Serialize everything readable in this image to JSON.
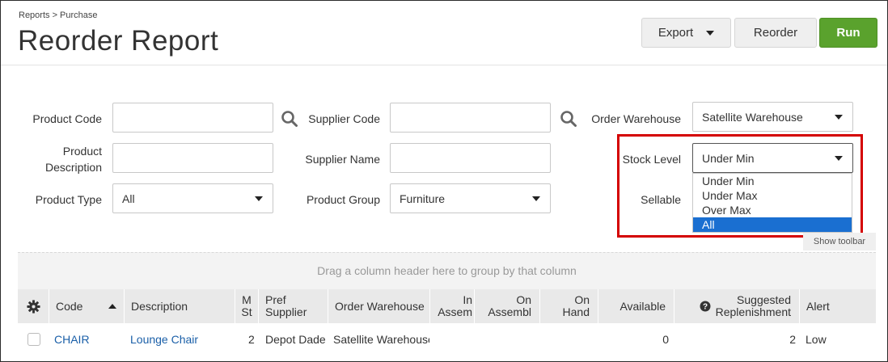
{
  "breadcrumb": "Reports > Purchase",
  "title": "Reorder Report",
  "toolbar": {
    "export": "Export",
    "reorder": "Reorder",
    "run": "Run"
  },
  "filters": {
    "product_code": {
      "label": "Product Code",
      "value": ""
    },
    "supplier_code": {
      "label": "Supplier Code",
      "value": ""
    },
    "order_warehouse": {
      "label": "Order Warehouse",
      "value": "Satellite Warehouse"
    },
    "product_description": {
      "label_line1": "Product",
      "label_line2": "Description",
      "value": ""
    },
    "supplier_name": {
      "label": "Supplier Name",
      "value": ""
    },
    "stock_level": {
      "label": "Stock Level",
      "value": "Under Min",
      "options": [
        "Under Min",
        "Under Max",
        "Over Max",
        "All"
      ],
      "highlighted": "All"
    },
    "product_type": {
      "label": "Product Type",
      "value": "All"
    },
    "product_group": {
      "label": "Product Group",
      "value": "Furniture"
    },
    "sellable": {
      "label": "Sellable"
    }
  },
  "show_toolbar": "Show toolbar",
  "group_hint": "Drag a column header here to group by that column",
  "columns": {
    "code": "Code",
    "description": "Description",
    "min_stock": [
      "M",
      "St"
    ],
    "pref_supplier": [
      "Pref",
      "Supplier"
    ],
    "order_warehouse": "Order Warehouse",
    "in_assembly": [
      "In",
      "Assem"
    ],
    "on_assembly": [
      "On",
      "Assembl"
    ],
    "on_hand": [
      "On",
      "Hand"
    ],
    "available": "Available",
    "suggested": [
      "Suggested",
      "Replenishment"
    ],
    "alert": "Alert"
  },
  "rows": [
    {
      "code": "CHAIR",
      "description": "Lounge Chair",
      "min_stock": "2",
      "pref_supplier": "Depot Dade",
      "order_warehouse": "Satellite Warehouse",
      "available": "0",
      "suggested": "2",
      "alert": "Low"
    }
  ],
  "colors": {
    "run": "#5aa22d",
    "highlight": "#d40000",
    "selected_option": "#1a6fd1",
    "link": "#1a5fa8"
  }
}
